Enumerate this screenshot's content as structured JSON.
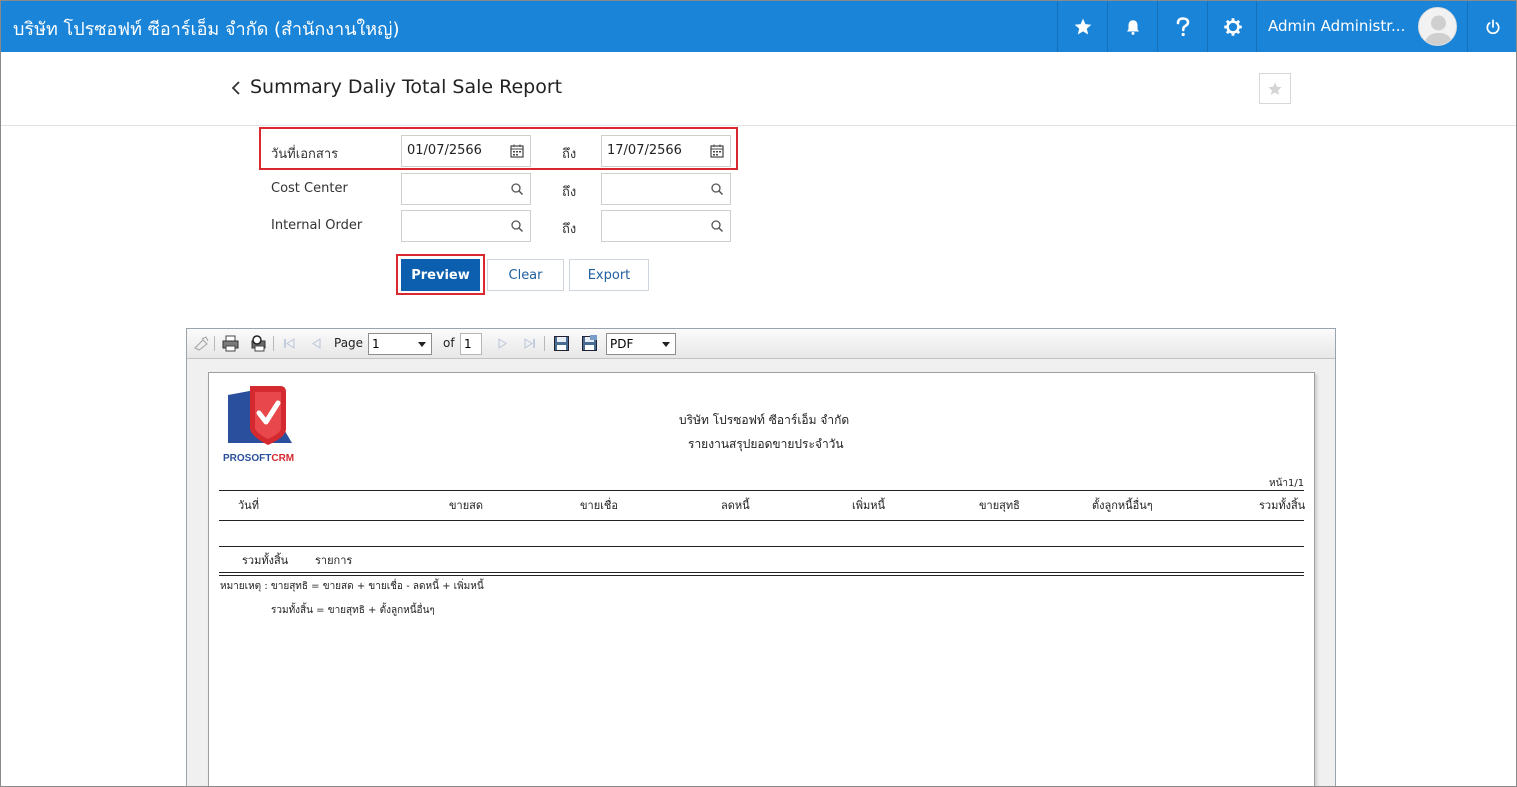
{
  "topbar": {
    "company": "บริษัท โปรซอฟท์ ซีอาร์เอ็ม จำกัด (สำนักงานใหญ่)",
    "username": "Admin Administr...",
    "icons": [
      "star-icon",
      "bell-icon",
      "help-icon",
      "gear-icon",
      "power-icon"
    ]
  },
  "header": {
    "title": "Summary Daliy Total Sale Report"
  },
  "form": {
    "doc_date_label": "วันที่เอกสาร",
    "date_from": "01/07/2566",
    "to_label": "ถึง",
    "date_to": "17/07/2566",
    "cost_center_label": "Cost Center",
    "internal_order_label": "Internal Order",
    "cost_center_from": "",
    "cost_center_to": "",
    "internal_order_from": "",
    "internal_order_to": ""
  },
  "buttons": {
    "preview": "Preview",
    "clear": "Clear",
    "export": "Export"
  },
  "viewer": {
    "page_label": "Page",
    "page_value": "1",
    "of_label": "of",
    "total_pages": "1",
    "format": "PDF"
  },
  "report": {
    "logo_text": "PROSOFT",
    "logo_text2": "CRM",
    "company": "บริษัท โปรซอฟท์ ซีอาร์เอ็ม จำกัด",
    "report_title": "รายงานสรุปยอดขายประจำวัน",
    "page_info": "หน้า1/1",
    "columns": [
      "วันที่",
      "ขายสด",
      "ขายเชื่อ",
      "ลดหนี้",
      "เพิ่มหนี้",
      "ขายสุทธิ",
      "ตั้งลูกหนี้อื่นๆ",
      "รวมทั้งสิ้น"
    ],
    "total_label": "รวมทั้งสิ้น",
    "items_label": "รายการ",
    "note_line1": "หมายเหตุ : ขายสุทธิ = ขายสด + ขายเชื่อ - ลดหนี้ + เพิ่มหนี้",
    "note_line2": "รวมทั้งสิ้น = ขายสุทธิ + ตั้งลูกหนี้อื่นๆ"
  },
  "colors": {
    "topbar": "#1a84d8",
    "primary_button": "#0c5fae",
    "highlight": "#d9282f",
    "logo_red": "#d42a2f",
    "logo_blue": "#2a4f9d"
  }
}
